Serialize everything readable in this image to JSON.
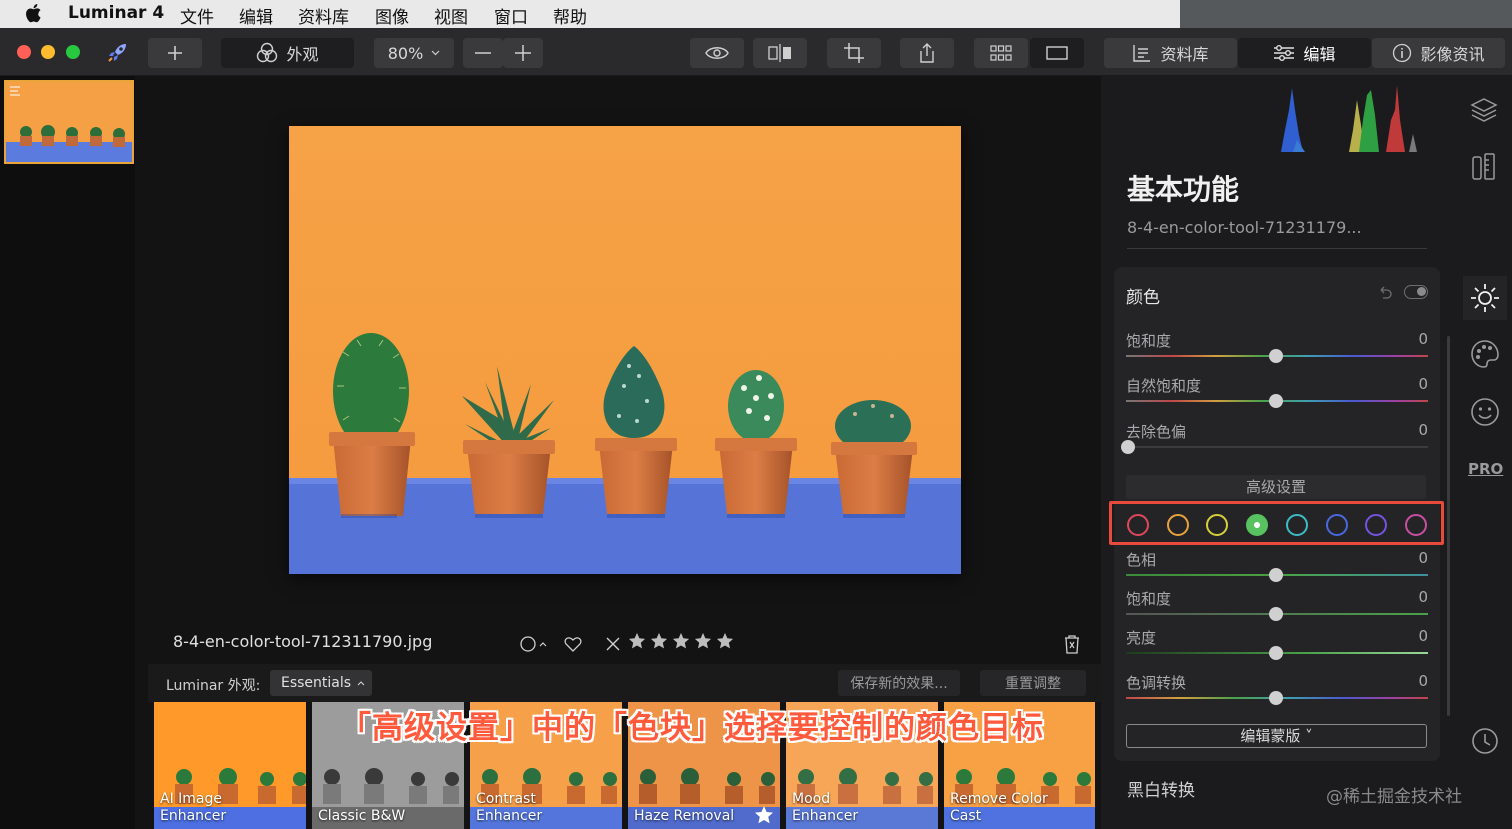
{
  "menubar": {
    "app_name": "Luminar 4",
    "items": [
      "文件",
      "编辑",
      "资料库",
      "图像",
      "视图",
      "窗口",
      "帮助"
    ]
  },
  "toolbar": {
    "looks_label": "外观",
    "zoom_value": "80%",
    "library_label": "资料库",
    "edit_label": "编辑",
    "info_label": "影像资讯"
  },
  "canvas": {
    "filename": "8-4-en-color-tool-712311790.jpg",
    "rating_stars": 5
  },
  "looks": {
    "label": "Luminar 外观:",
    "category": "Essentials",
    "save_label": "保存新的效果...",
    "reset_label": "重置调整",
    "items": [
      {
        "name": "AI Image\nEnhancer"
      },
      {
        "name": "Classic B&W"
      },
      {
        "name": "Contrast\nEnhancer"
      },
      {
        "name": "Haze Removal"
      },
      {
        "name": "Mood\nEnhancer"
      },
      {
        "name": "Remove Color\nCast"
      }
    ]
  },
  "panel": {
    "section_title": "基本功能",
    "filename": "8-4-en-color-tool-71231179...",
    "card_title": "颜色",
    "sliders_top": [
      {
        "label": "饱和度",
        "value": "0"
      },
      {
        "label": "自然饱和度",
        "value": "0"
      },
      {
        "label": "去除色偏",
        "value": "0"
      }
    ],
    "advanced_label": "高级设置",
    "sliders_bottom": [
      {
        "label": "色相",
        "value": "0"
      },
      {
        "label": "饱和度",
        "value": "0"
      },
      {
        "label": "亮度",
        "value": "0"
      },
      {
        "label": "色调转换",
        "value": "0"
      }
    ],
    "mask_label": "编辑蒙版",
    "next_section": "黑白转换",
    "pro_label": "PRO"
  },
  "color_targets": [
    {
      "name": "red",
      "color": "#e0475a",
      "selected": false
    },
    {
      "name": "orange",
      "color": "#e8a23c",
      "selected": false
    },
    {
      "name": "yellow",
      "color": "#d6cf3a",
      "selected": false
    },
    {
      "name": "green",
      "color": "#58c260",
      "selected": true
    },
    {
      "name": "aqua",
      "color": "#3bbdc4",
      "selected": false
    },
    {
      "name": "blue",
      "color": "#4968e0",
      "selected": false
    },
    {
      "name": "purple",
      "color": "#7552e0",
      "selected": false
    },
    {
      "name": "magenta",
      "color": "#c94fa0",
      "selected": false
    }
  ],
  "annotation": {
    "text": "「高级设置」中的「色块」选择要控制的颜色目标",
    "highlight_color": "#e84a3c"
  },
  "watermark": "@稀土掘金技术社区"
}
